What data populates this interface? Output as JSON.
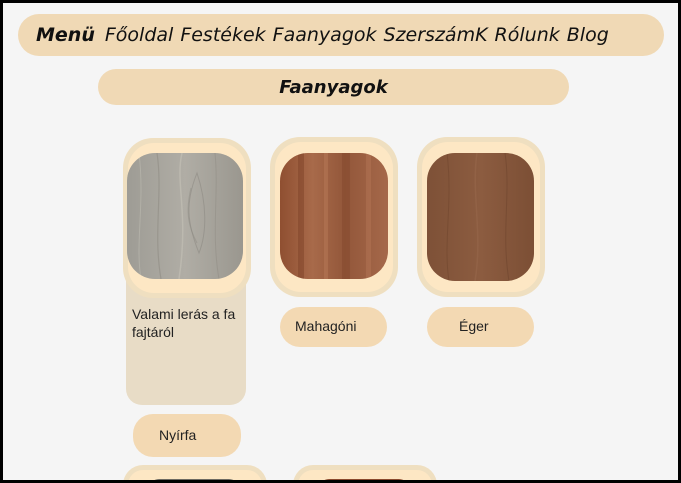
{
  "nav": {
    "menu_label": "Menü",
    "links": [
      "Főoldal",
      "Festékek",
      "Faanyagok",
      "SzerszámK",
      "Rólunk",
      "Blog"
    ]
  },
  "section": {
    "title": "Faanyagok"
  },
  "woods": [
    {
      "name": "Nyírfa",
      "description": "Valami lerás a fa fajtáról",
      "color": "#a8a59c"
    },
    {
      "name": "Mahagóni",
      "color": "#9a5a3c"
    },
    {
      "name": "Éger",
      "color": "#8a5a3c"
    }
  ],
  "colors": {
    "nav_background": "#f0d9b5",
    "pill_background": "#f3d9b3",
    "page_background": "#f5f5f5"
  }
}
